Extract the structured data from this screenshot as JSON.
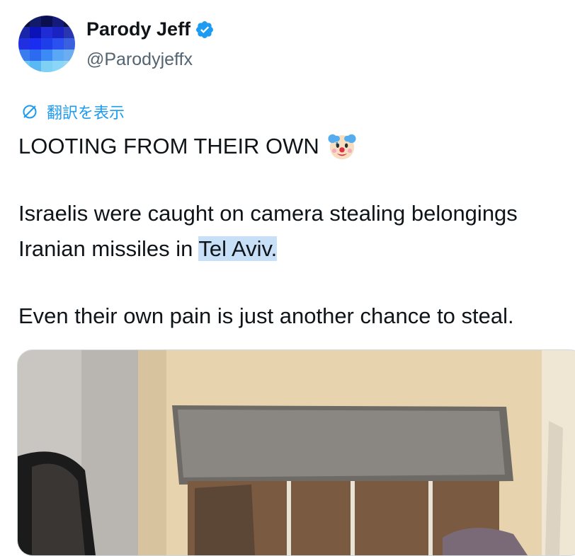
{
  "author": {
    "display_name": "Parody Jeff",
    "handle": "@Parodyjeffx",
    "verified": true,
    "verified_color": "#1d9bf0"
  },
  "translate": {
    "label": "翻訳を表示",
    "icon": "globe-slash-icon",
    "color": "#1d9bf0"
  },
  "tweet": {
    "line1": "LOOTING FROM THEIR OWN",
    "emoji": "clown-face-icon",
    "line2": "Israelis were caught on camera stealing belongings",
    "line3_prefix": "Iranian missiles in ",
    "line3_highlight": "Tel Aviv.",
    "line4": "Even their own pain is just another chance to steal."
  },
  "media": {
    "type": "video-thumbnail"
  }
}
